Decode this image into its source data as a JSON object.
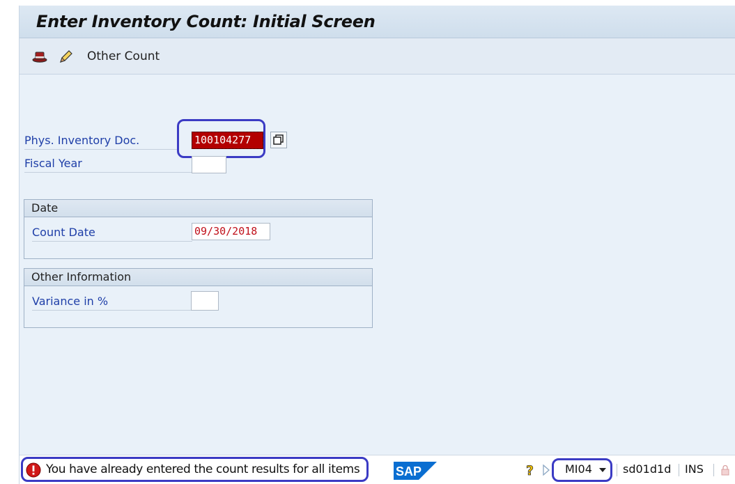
{
  "header": {
    "title": "Enter Inventory Count: Initial Screen"
  },
  "toolbar": {
    "icons": [
      "hat-icon",
      "pencil-icon"
    ],
    "other_count_label": "Other Count"
  },
  "fields": {
    "phys_doc": {
      "label": "Phys. Inventory Doc.",
      "value": "100104277"
    },
    "fiscal_year": {
      "label": "Fiscal Year",
      "value": ""
    }
  },
  "groups": {
    "date": {
      "title": "Date",
      "count_date_label": "Count Date",
      "count_date_value": "09/30/2018"
    },
    "other_info": {
      "title": "Other Information",
      "variance_label": "Variance in %",
      "variance_value": ""
    }
  },
  "status": {
    "message": "You have already entered the count results for all items",
    "message_type": "error",
    "logo": "SAP",
    "transaction": "MI04",
    "system": "sd01d1d",
    "mode": "INS"
  },
  "colors": {
    "accent_blue": "#1f3fa8",
    "selection_red": "#b30000",
    "highlight": "#3b3bc4",
    "sap_logo": "#0a6ed1"
  }
}
